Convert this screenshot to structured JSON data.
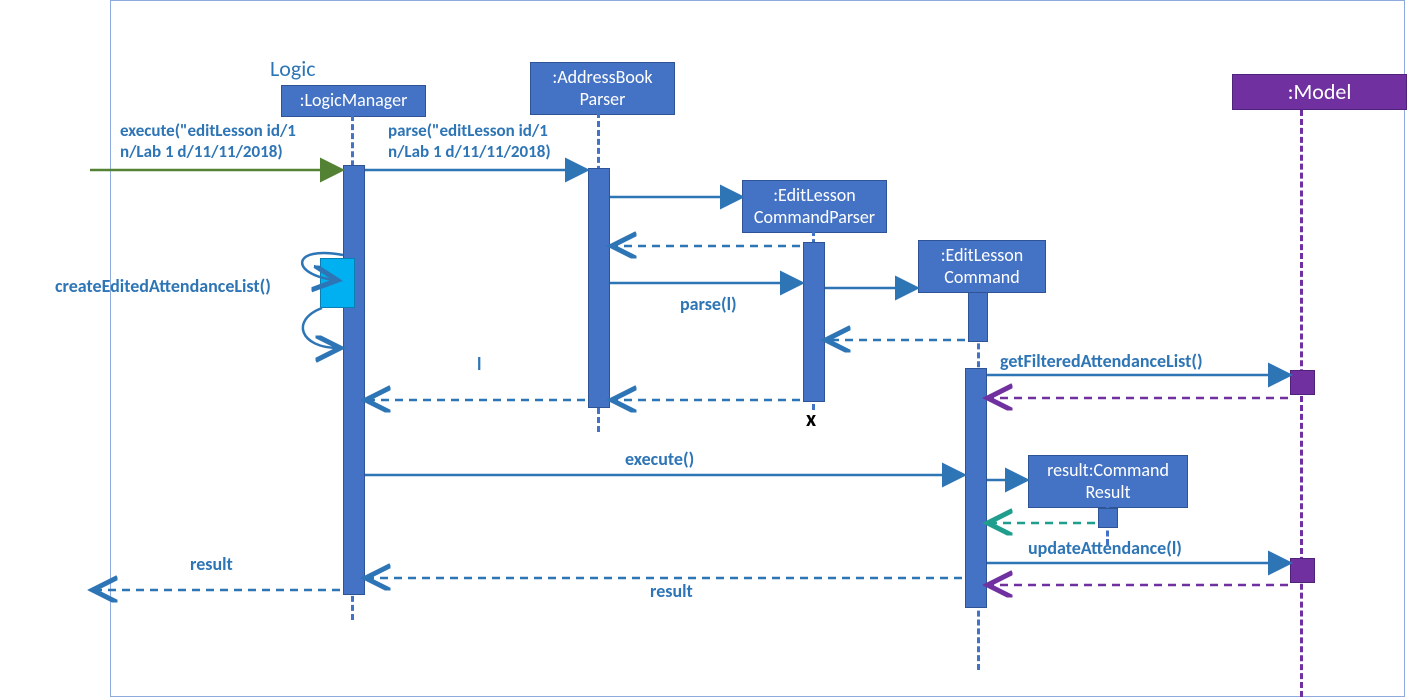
{
  "logicLabel": "Logic",
  "participants": {
    "logicManager": ":LogicManager",
    "addressBookParser": ":AddressBook\nParser",
    "editLessonCommandParser": ":EditLesson\nCommandParser",
    "editLessonCommand": ":EditLesson\nCommand",
    "model": ":Model",
    "commandResult": "result:Command\nResult"
  },
  "messages": {
    "executeIn": "execute(\"editLesson id/1\nn/Lab 1 d/11/11/2018)",
    "parseIn": "parse(\"editLesson id/1\nn/Lab 1 d/11/11/2018)",
    "parseL": "parse(l)",
    "returnL": "l",
    "createEditedAttendanceList": "createEditedAttendanceList()",
    "getFilteredAttendanceList": "getFilteredAttendanceList()",
    "execute": "execute()",
    "updateAttendance": "updateAttendance(l)",
    "result": "result",
    "resultLower": "result"
  },
  "destroy": "x"
}
